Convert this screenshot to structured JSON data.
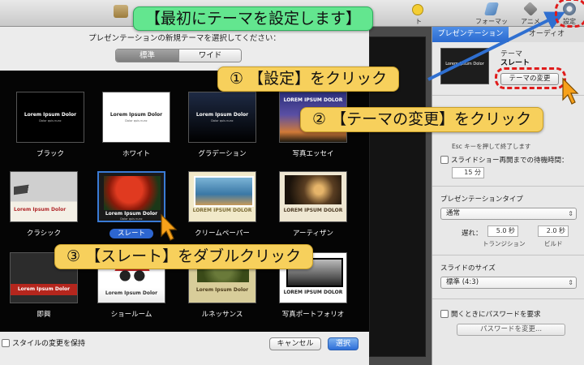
{
  "toolbar": {
    "partial_left_label": "",
    "partial_right_label": "ト",
    "format_label": "フォーマット",
    "animation_label": "アニメ",
    "setup_label": "設定"
  },
  "dialog": {
    "title": "プレゼンテーションの新規テーマを選択してください：",
    "ratio_standard": "標準",
    "ratio_wide": "ワイド",
    "themes": [
      {
        "name": "ブラック",
        "thumb_title": "Lorem Ipsum Dolor",
        "thumb_sub": "Dolor quis nunc"
      },
      {
        "name": "ホワイト",
        "thumb_title": "Lorem Ipsum Dolor",
        "thumb_sub": "Dolor quis nunc"
      },
      {
        "name": "グラデーション",
        "thumb_title": "Lorem Ipsum Dolor",
        "thumb_sub": "Dolor quis nunc"
      },
      {
        "name": "写真エッセイ",
        "thumb_title": "LOREM IPSUM DOLOR",
        "thumb_sub": ""
      },
      {
        "name": "クラシック",
        "thumb_title": "Lorem Ipsum Dolor",
        "thumb_sub": ""
      },
      {
        "name": "スレート",
        "thumb_title": "Lorem Ipsum Dolor",
        "thumb_sub": "Dolor quis nunc"
      },
      {
        "name": "クリームペーパー",
        "thumb_title": "LOREM IPSUM DOLOR",
        "thumb_sub": ""
      },
      {
        "name": "アーティザン",
        "thumb_title": "LOREM IPSUM DOLOR",
        "thumb_sub": ""
      },
      {
        "name": "即興",
        "thumb_title": "Lorem Ipsum Dolor",
        "thumb_sub": ""
      },
      {
        "name": "ショールーム",
        "thumb_title": "Lorem Ipsum Dolor",
        "thumb_sub": ""
      },
      {
        "name": "ルネッサンス",
        "thumb_title": "Lorem Ipsum Dolor",
        "thumb_sub": ""
      },
      {
        "name": "写真ポートフォリオ",
        "thumb_title": "LOREM IPSUM DOLOR",
        "thumb_sub": ""
      }
    ],
    "selected_theme": "スレート",
    "keep_style_label": "スタイルの変更を保持",
    "cancel_label": "キャンセル",
    "choose_label": "選択"
  },
  "inspector": {
    "tab_presentation": "プレゼンテーション",
    "tab_audio": "オーディオ",
    "theme_preview_title": "Lorem Ipsum Dolor",
    "theme_caption": "テーマ",
    "theme_name": "スレート",
    "change_theme_label": "テーマの変更",
    "slideshow_restart_label": "スライドショー再開までの待機時間：",
    "esc_hint": "Esc キーを押して終了します",
    "wait_value": "15 分",
    "presentation_type_heading": "プレゼンテーションタイプ",
    "presentation_type_value": "通常",
    "delay_label": "遅れ：",
    "transition_value": "5.0 秒",
    "build_value": "2.0 秒",
    "transition_label": "トランジション",
    "build_label": "ビルド",
    "slide_size_heading": "スライドのサイズ",
    "slide_size_value": "標準 (4:3)",
    "password_open_label": "開くときにパスワードを要求",
    "password_change_label": "パスワードを変更..."
  },
  "tutorial": {
    "top_banner": "【最初にテーマを設定します】",
    "step1": "① 【設定】をクリック",
    "step2": "② 【テーマの変更】をクリック",
    "step3": "③ 【スレート】をダブルクリック"
  },
  "colors": {
    "callout_yellow": "#f7d05c",
    "banner_green": "#63e68f",
    "highlight_red": "#e01b1b",
    "selection_blue": "#2d66d0"
  }
}
